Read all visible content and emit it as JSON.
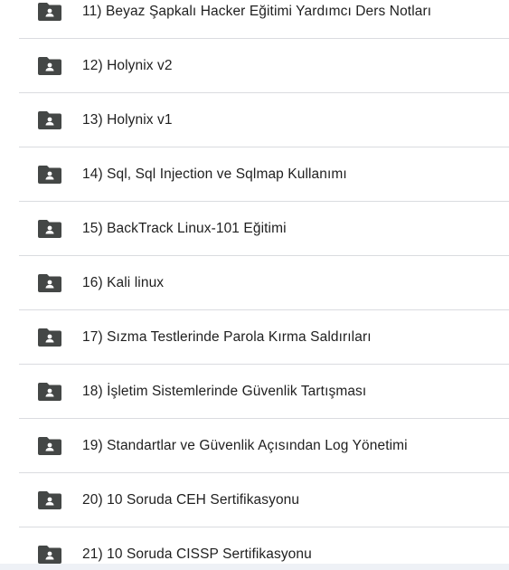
{
  "folders": [
    {
      "name": "11) Beyaz Şapkalı Hacker Eğitimi Yardımcı Ders Notları",
      "icon": "shared-folder-icon"
    },
    {
      "name": "12) Holynix v2",
      "icon": "shared-folder-icon"
    },
    {
      "name": "13) Holynix v1",
      "icon": "shared-folder-icon"
    },
    {
      "name": "14) Sql, Sql Injection ve Sqlmap Kullanımı",
      "icon": "shared-folder-icon"
    },
    {
      "name": "15) BackTrack Linux-101 Eğitimi",
      "icon": "shared-folder-icon"
    },
    {
      "name": "16) Kali linux",
      "icon": "shared-folder-icon"
    },
    {
      "name": "17) Sızma Testlerinde Parola Kırma Saldırıları",
      "icon": "shared-folder-icon"
    },
    {
      "name": "18) İşletim Sistemlerinde Güvenlik Tartışması",
      "icon": "shared-folder-icon"
    },
    {
      "name": "19) Standartlar ve Güvenlik Açısından Log Yönetimi",
      "icon": "shared-folder-icon"
    },
    {
      "name": "20) 10 Soruda CEH Sertifikasyonu",
      "icon": "shared-folder-icon"
    },
    {
      "name": "21) 10 Soruda CISSP Sertifikasyonu",
      "icon": "shared-folder-icon"
    }
  ],
  "colors": {
    "folder_icon": "#444746",
    "text": "#1f1f1f",
    "divider": "#dadce0"
  }
}
